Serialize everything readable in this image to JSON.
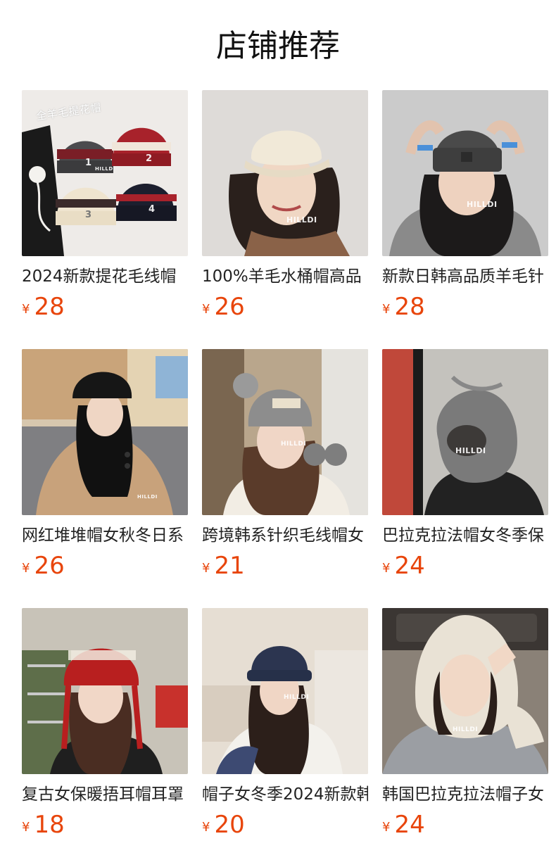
{
  "section": {
    "title": "店铺推荐"
  },
  "products": [
    {
      "name": "2024新款提花毛线帽",
      "currency": "¥",
      "price": "28",
      "image_text": "全羊毛提花帽",
      "image_labels": [
        "1",
        "2",
        "3",
        "4"
      ],
      "watermark": "HILLDI",
      "bg": "#ece9e6",
      "hat": "#4b4b4e"
    },
    {
      "name": "100%羊毛水桶帽高品",
      "currency": "¥",
      "price": "26",
      "watermark": "HILLDI",
      "bg": "#dedbd8",
      "hat": "#f1e9d8"
    },
    {
      "name": "新款日韩高品质羊毛针",
      "currency": "¥",
      "price": "28",
      "watermark": "HILLDI",
      "bg": "#c9c9c9",
      "hat": "#4a4a4a"
    },
    {
      "name": "网红堆堆帽女秋冬日系",
      "currency": "¥",
      "price": "26",
      "watermark": "HILLDI",
      "bg": "#c9b59a",
      "hat": "#161616"
    },
    {
      "name": "跨境韩系针织毛线帽女",
      "currency": "¥",
      "price": "21",
      "watermark": "HILLDI",
      "bg": "#b9a68c",
      "hat": "#8d8d8d"
    },
    {
      "name": "巴拉克拉法帽女冬季保",
      "currency": "¥",
      "price": "24",
      "watermark": "HILLDI",
      "bg": "#bfbdb8",
      "hat": "#777777"
    },
    {
      "name": "复古女保暖捂耳帽耳罩",
      "currency": "¥",
      "price": "18",
      "bg": "#b9b4a9",
      "hat": "#b81f1f"
    },
    {
      "name": "帽子女冬季2024新款韩",
      "currency": "¥",
      "price": "20",
      "watermark": "HILLDI",
      "bg": "#e4dcd1",
      "hat": "#2c3550"
    },
    {
      "name": "韩国巴拉克拉法帽子女",
      "currency": "¥",
      "price": "24",
      "watermark": "HILLDI",
      "bg": "#8c8378",
      "hat": "#e9e2d5"
    }
  ]
}
